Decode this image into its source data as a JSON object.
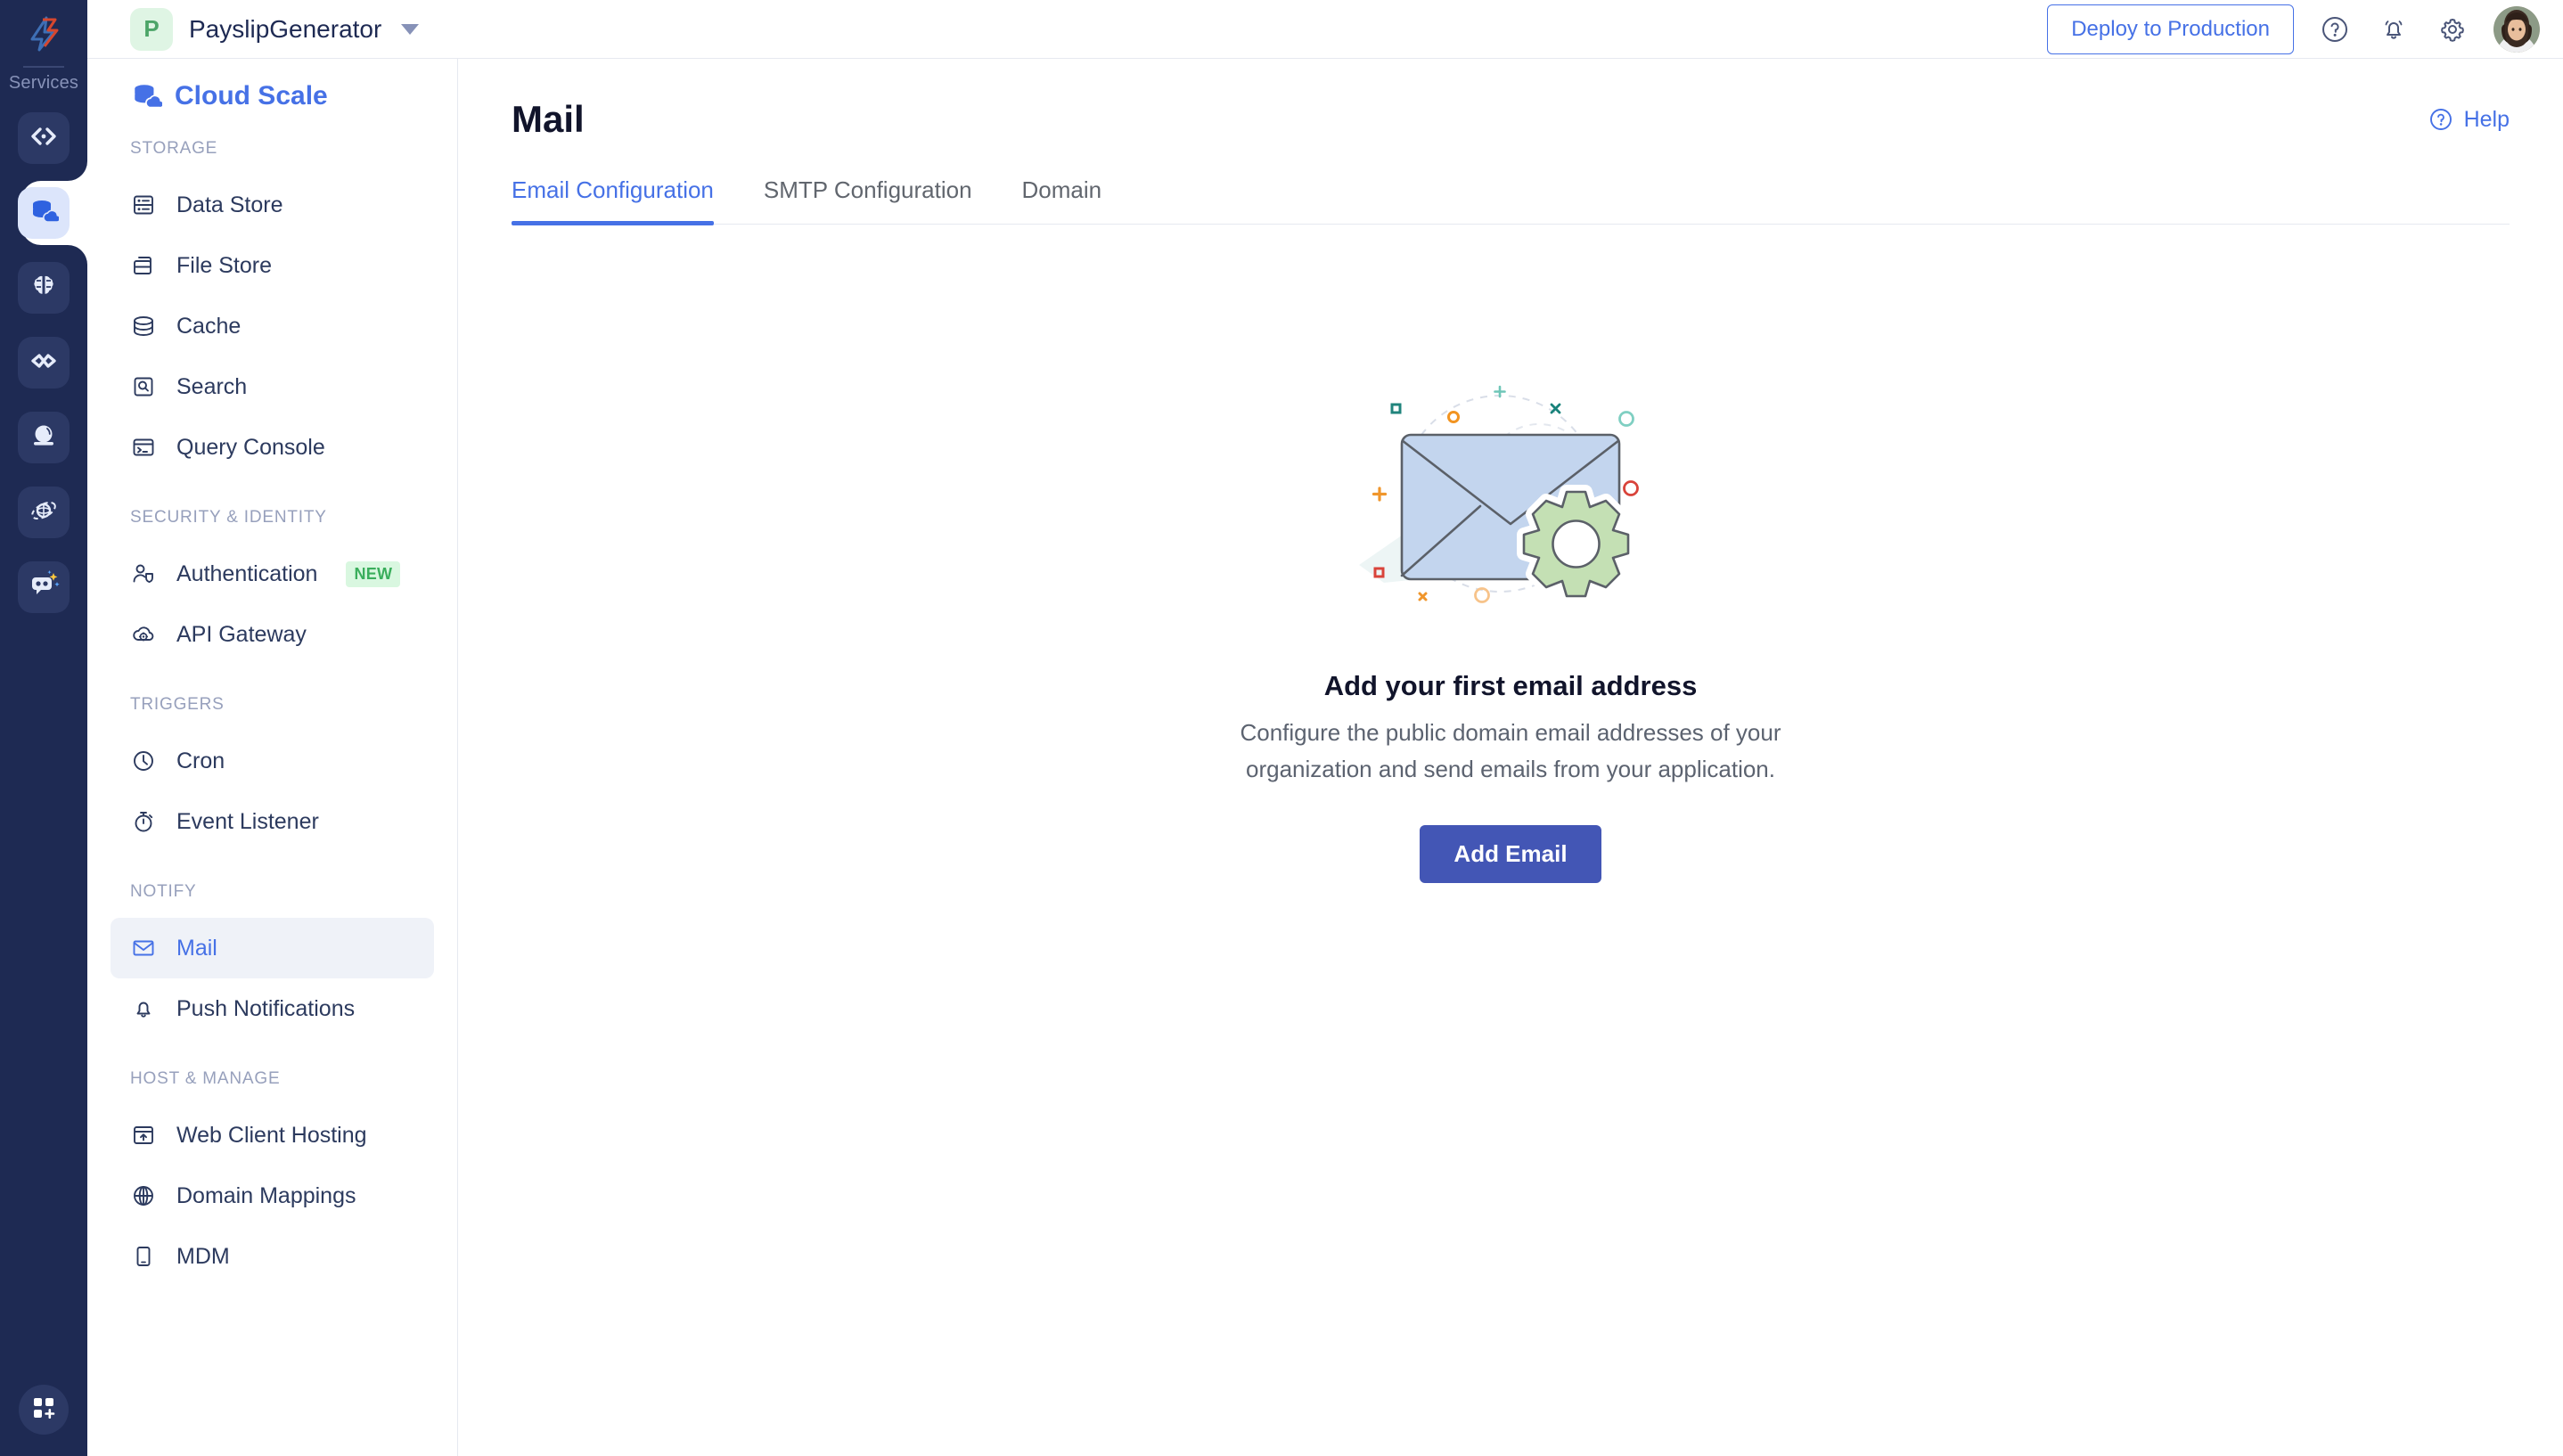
{
  "colors": {
    "rail_bg": "#1E2A53",
    "accent_blue": "#4671E6",
    "button_blue": "#4356B5",
    "badge_green_bg": "#D9F7E0",
    "badge_green_text": "#3AAE5C",
    "active_item_bg": "#EFF2F8",
    "text_dark": "#2C3A5E",
    "text_muted": "#97A0BC"
  },
  "rail": {
    "logo_name": "catalyst-logo",
    "services_label": "Services",
    "items": [
      {
        "icon": "code-brackets-icon",
        "name": "develop",
        "active": false
      },
      {
        "icon": "database-cloud-icon",
        "name": "cloud-scale",
        "active": true
      },
      {
        "icon": "brain-icon",
        "name": "smart-browz",
        "active": false
      },
      {
        "icon": "infinity-icon",
        "name": "devops",
        "active": false
      },
      {
        "icon": "crystal-ball-icon",
        "name": "quick-ml",
        "active": false
      },
      {
        "icon": "globe-orbit-icon",
        "name": "web-app",
        "active": false
      },
      {
        "icon": "chat-bot-sparkle-icon",
        "name": "ai-assistant",
        "active": false
      }
    ],
    "add_button_icon": "grid-plus-icon"
  },
  "topbar": {
    "project_initial": "P",
    "project_name": "PayslipGenerator",
    "project_dropdown_icon": "chevron-down-icon",
    "deploy_label": "Deploy to Production",
    "icons": [
      {
        "name": "help-circle-icon"
      },
      {
        "name": "notification-bell-icon"
      },
      {
        "name": "settings-gear-icon"
      }
    ],
    "avatar_name": "user-avatar"
  },
  "sidebar": {
    "service_title": "Cloud Scale",
    "service_icon": "database-cloud-icon",
    "groups": [
      {
        "label": "STORAGE",
        "items": [
          {
            "label": "Data Store",
            "icon": "data-store-icon",
            "active": false,
            "badge": null
          },
          {
            "label": "File Store",
            "icon": "file-store-icon",
            "active": false,
            "badge": null
          },
          {
            "label": "Cache",
            "icon": "cache-icon",
            "active": false,
            "badge": null
          },
          {
            "label": "Search",
            "icon": "search-icon",
            "active": false,
            "badge": null
          },
          {
            "label": "Query Console",
            "icon": "query-console-icon",
            "active": false,
            "badge": null
          }
        ]
      },
      {
        "label": "SECURITY & IDENTITY",
        "items": [
          {
            "label": "Authentication",
            "icon": "user-shield-icon",
            "active": false,
            "badge": "NEW"
          },
          {
            "label": "API Gateway",
            "icon": "cloud-gear-icon",
            "active": false,
            "badge": null
          }
        ]
      },
      {
        "label": "TRIGGERS",
        "items": [
          {
            "label": "Cron",
            "icon": "clock-icon",
            "active": false,
            "badge": null
          },
          {
            "label": "Event Listener",
            "icon": "stopwatch-icon",
            "active": false,
            "badge": null
          }
        ]
      },
      {
        "label": "NOTIFY",
        "items": [
          {
            "label": "Mail",
            "icon": "envelope-icon",
            "active": true,
            "badge": null
          },
          {
            "label": "Push Notifications",
            "icon": "bell-icon",
            "active": false,
            "badge": null
          }
        ]
      },
      {
        "label": "HOST & MANAGE",
        "items": [
          {
            "label": "Web Client Hosting",
            "icon": "upload-window-icon",
            "active": false,
            "badge": null
          },
          {
            "label": "Domain Mappings",
            "icon": "globe-icon",
            "active": false,
            "badge": null
          },
          {
            "label": "MDM",
            "icon": "mobile-device-icon",
            "active": false,
            "badge": null
          }
        ]
      }
    ]
  },
  "main": {
    "title": "Mail",
    "help_label": "Help",
    "help_icon": "help-circle-icon",
    "tabs": [
      {
        "label": "Email Configuration",
        "active": true
      },
      {
        "label": "SMTP Configuration",
        "active": false
      },
      {
        "label": "Domain",
        "active": false
      }
    ],
    "empty_state": {
      "illustration_name": "envelope-gear-illustration",
      "title": "Add your first email address",
      "description": "Configure the public domain email addresses of your organization and send emails from your application.",
      "button_label": "Add Email"
    }
  }
}
